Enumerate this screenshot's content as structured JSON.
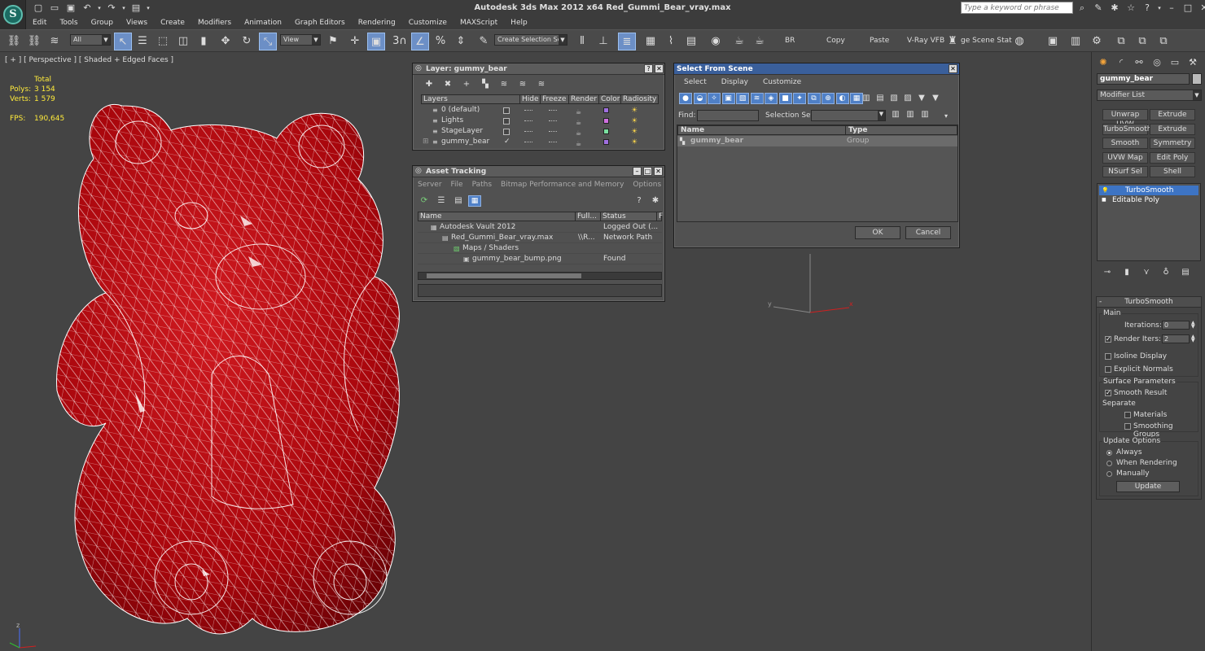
{
  "titlebar": {
    "title": "Autodesk 3ds Max  2012 x64      Red_Gummi_Bear_vray.max",
    "search_placeholder": "Type a keyword or phrase"
  },
  "menu": [
    "Edit",
    "Tools",
    "Group",
    "Views",
    "Create",
    "Modifiers",
    "Animation",
    "Graph Editors",
    "Rendering",
    "Customize",
    "MAXScript",
    "Help"
  ],
  "toolbar": {
    "filter": "All",
    "ref_coord": "View",
    "selection_set": "Create Selection Se",
    "snap_label": "3",
    "br_label": "BR",
    "copy_label": "Copy",
    "paste_label": "Paste",
    "vfb_label": "V-Ray VFB",
    "stage_label": "ge Scene Stat"
  },
  "viewport": {
    "label": "[ + ] [ Perspective ] [ Shaded + Edged Faces ]",
    "stats": {
      "header": "Total",
      "polys_label": "Polys:",
      "polys": "3 154",
      "verts_label": "Verts:",
      "verts": "1 579",
      "fps_label": "FPS:",
      "fps": "190,645"
    },
    "axis_y": "y",
    "axis_x": "x",
    "corner_z": "z"
  },
  "layer_dialog": {
    "title": "Layer: gummy_bear",
    "columns": [
      "Layers",
      "Hide",
      "Freeze",
      "Render",
      "Color",
      "Radiosity"
    ],
    "rows": [
      {
        "name": "0 (default)",
        "color": "#a070e0",
        "current": false
      },
      {
        "name": "Lights",
        "color": "#d070e0",
        "current": false
      },
      {
        "name": "StageLayer",
        "color": "#7ae0a0",
        "current": false
      },
      {
        "name": "gummy_bear",
        "color": "#a070e0",
        "current": true
      }
    ],
    "check_mark": "✓",
    "plus_mark": "⊞"
  },
  "asset_dialog": {
    "title": "Asset Tracking",
    "menu": [
      "Server",
      "File",
      "Paths",
      "Bitmap Performance and Memory",
      "Options"
    ],
    "columns": [
      "Name",
      "Full...",
      "Status",
      "F"
    ],
    "rows": [
      {
        "name": "Autodesk Vault 2012",
        "full": "",
        "status": "Logged Out (..."
      },
      {
        "name": "Red_Gummi_Bear_vray.max",
        "full": "\\\\R...",
        "status": "Network Path"
      },
      {
        "name": "Maps / Shaders",
        "full": "",
        "status": ""
      },
      {
        "name": "gummy_bear_bump.png",
        "full": "",
        "status": "Found"
      }
    ]
  },
  "select_dialog": {
    "title": "Select From Scene",
    "menu": [
      "Select",
      "Display",
      "Customize"
    ],
    "find_label": "Find:",
    "selset_label": "Selection Set:",
    "columns": [
      "Name",
      "Type"
    ],
    "row": {
      "name": "gummy_bear",
      "type": "Group"
    },
    "ok_label": "OK",
    "cancel_label": "Cancel"
  },
  "command_panel": {
    "object_name": "gummy_bear",
    "modifier_list": "Modifier List",
    "modifier_buttons": [
      [
        "Unwrap UVW",
        "Extrude"
      ],
      [
        "TurboSmooth",
        "Extrude"
      ],
      [
        "Smooth",
        "Symmetry"
      ],
      [
        "UVW Map",
        "Edit Poly"
      ],
      [
        "NSurf Sel",
        "Shell"
      ]
    ],
    "stack": [
      {
        "name": "TurboSmooth",
        "selected": true
      },
      {
        "name": "Editable Poly",
        "selected": false
      }
    ],
    "rollout_title": "TurboSmooth",
    "main_group": "Main",
    "iterations_label": "Iterations:",
    "iterations": "0",
    "render_iters_label": "Render Iters:",
    "render_iters": "2",
    "render_iters_checked": true,
    "isoline_label": "Isoline Display",
    "explicit_label": "Explicit Normals",
    "surface_group": "Surface Parameters",
    "smooth_result_label": "Smooth Result",
    "separate_label": "Separate",
    "materials_label": "Materials",
    "smoothing_label": "Smoothing Groups",
    "update_group": "Update Options",
    "always_label": "Always",
    "when_rendering_label": "When Rendering",
    "manually_label": "Manually",
    "update_button": "Update"
  },
  "colors": {
    "bear_fill": "#b3070e",
    "wire": "#ffffff",
    "viewport_bg": "#444444",
    "selection_blue": "#3d74c4"
  }
}
